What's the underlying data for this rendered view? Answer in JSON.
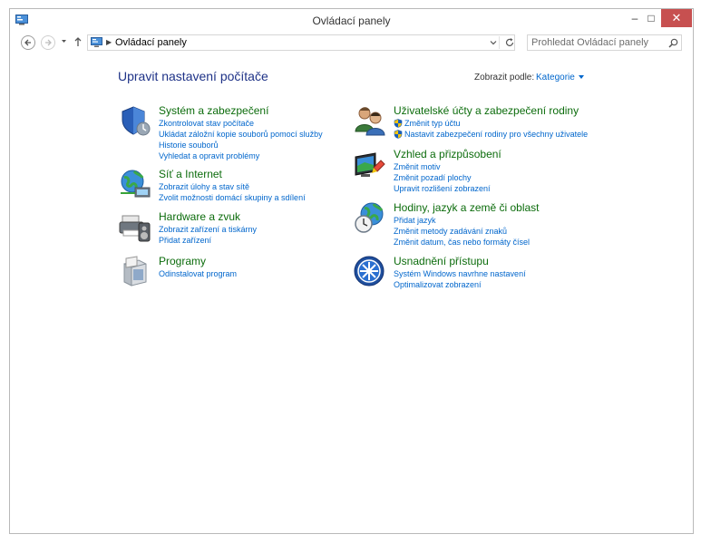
{
  "window": {
    "title": "Ovládací panely",
    "buttons": {
      "minimize": "–",
      "maximize": "□",
      "close": "✕"
    }
  },
  "address": {
    "crumb": "Ovládací panely",
    "separator": "▶"
  },
  "search": {
    "placeholder": "Prohledat Ovládací panely"
  },
  "content": {
    "heading": "Upravit nastavení počítače",
    "view_label": "Zobrazit podle:",
    "view_value": "Kategorie"
  },
  "left": [
    {
      "icon": "security-shield-icon",
      "title": "Systém a zabezpečení",
      "links": [
        "Zkontrolovat stav počítače",
        "Ukládat záložní kopie souborů pomocí služby",
        "Historie souborů",
        "Vyhledat a opravit problémy"
      ]
    },
    {
      "icon": "network-globe-icon",
      "title": "Síť a Internet",
      "links": [
        "Zobrazit úlohy a stav sítě",
        "Zvolit možnosti domácí skupiny a sdílení"
      ]
    },
    {
      "icon": "printer-speaker-icon",
      "title": "Hardware a zvuk",
      "links": [
        "Zobrazit zařízení a tiskárny",
        "Přidat zařízení"
      ]
    },
    {
      "icon": "programs-box-icon",
      "title": "Programy",
      "links": [
        "Odinstalovat program"
      ]
    }
  ],
  "right": [
    {
      "icon": "users-icon",
      "title": "Uživatelské účty a zabezpečení rodiny",
      "links": [
        "Změnit typ účtu",
        "Nastavit zabezpečení rodiny pro všechny uživatele"
      ]
    },
    {
      "icon": "appearance-monitor-icon",
      "title": "Vzhled a přizpůsobení",
      "links": [
        "Změnit motiv",
        "Změnit pozadí plochy",
        "Upravit rozlišení zobrazení"
      ]
    },
    {
      "icon": "clock-globe-icon",
      "title": "Hodiny, jazyk a země či oblast",
      "links": [
        "Přidat jazyk",
        "Změnit metody zadávání znaků",
        "Změnit datum, čas nebo formáty čísel"
      ]
    },
    {
      "icon": "ease-of-access-icon",
      "title": "Usnadnění přístupu",
      "links": [
        "Systém Windows navrhne nastavení",
        "Optimalizovat zobrazení"
      ]
    }
  ]
}
